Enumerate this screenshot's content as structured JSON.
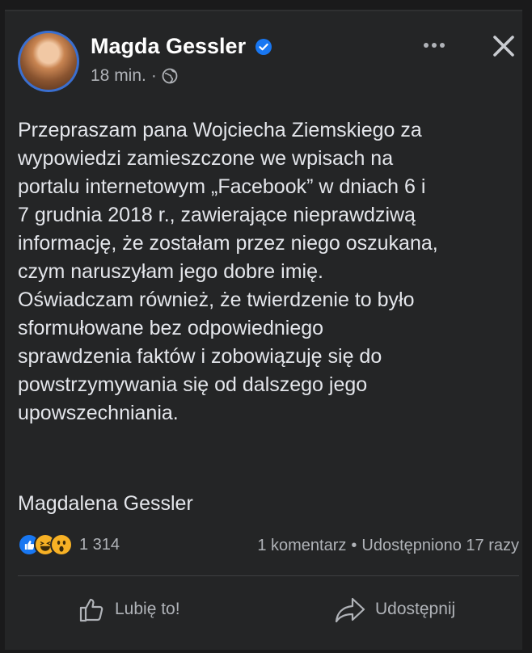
{
  "post": {
    "author": "Magda Gessler",
    "time": "18 min.",
    "separator": "·",
    "verified_icon": "verified-badge-icon",
    "audience_icon": "globe-icon",
    "text": "Przepraszam pana Wojciecha Ziemskiego za\nwypowiedzi zamieszczone we wpisach na\nportalu internetowym „Facebook” w dniach 6 i\n7 grudnia 2018 r., zawierające nieprawdziwą\ninformację, że zostałam przez niego oszukana,\nczym naruszyłam jego dobre imię.\nOświadczam również, że twierdzenie to było\nsformułowane bez odpowiedniego\nsprawdzenia faktów i zobowiązuję się do\npowstrzymywania się od dalszego jego\nupowszechniania.",
    "signature": "Magdalena Gessler"
  },
  "stats": {
    "reaction_count": "1 314",
    "comments": "1 komentarz",
    "dot": "•",
    "shares": "Udostępniono 17 razy"
  },
  "actions": {
    "like": "Lubię to!",
    "share": "Udostępnij"
  },
  "colors": {
    "background": "#242526",
    "accent": "#1877f2",
    "text": "#e4e6eb",
    "secondary": "#b0b3b8"
  }
}
